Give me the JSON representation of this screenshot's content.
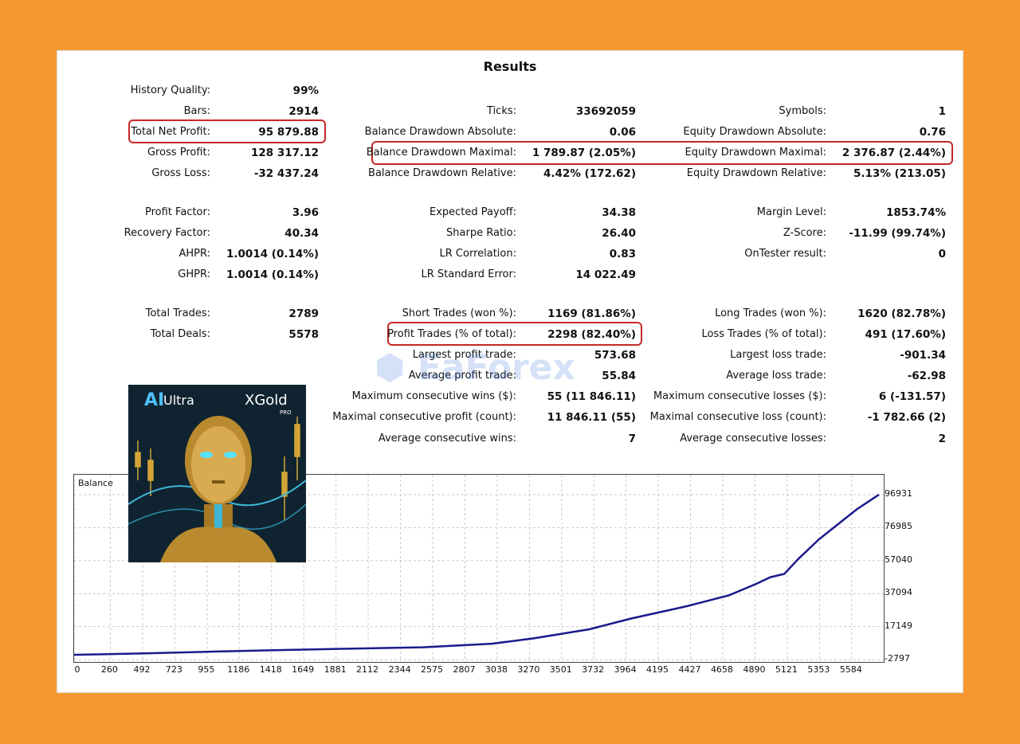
{
  "title": "Results",
  "col1": [
    {
      "label": "History Quality:",
      "value": "99%"
    },
    {
      "label": "Bars:",
      "value": "2914"
    },
    {
      "label": "Total Net Profit:",
      "value": "95 879.88"
    },
    {
      "label": "Gross Profit:",
      "value": "128 317.12"
    },
    {
      "label": "Gross Loss:",
      "value": "-32 437.24"
    },
    {
      "label": "Profit Factor:",
      "value": "3.96"
    },
    {
      "label": "Recovery Factor:",
      "value": "40.34"
    },
    {
      "label": "AHPR:",
      "value": "1.0014 (0.14%)"
    },
    {
      "label": "GHPR:",
      "value": "1.0014 (0.14%)"
    },
    {
      "label": "Total Trades:",
      "value": "2789"
    },
    {
      "label": "Total Deals:",
      "value": "5578"
    }
  ],
  "col2": [
    {
      "label": "Ticks:",
      "value": "33692059"
    },
    {
      "label": "Balance Drawdown Absolute:",
      "value": "0.06"
    },
    {
      "label": "Balance Drawdown Maximal:",
      "value": "1 789.87 (2.05%)"
    },
    {
      "label": "Balance Drawdown Relative:",
      "value": "4.42% (172.62)"
    },
    {
      "label": "Expected Payoff:",
      "value": "34.38"
    },
    {
      "label": "Sharpe Ratio:",
      "value": "26.40"
    },
    {
      "label": "LR Correlation:",
      "value": "0.83"
    },
    {
      "label": "LR Standard Error:",
      "value": "14 022.49"
    },
    {
      "label": "Short Trades (won %):",
      "value": "1169 (81.86%)"
    },
    {
      "label": "Profit Trades (% of total):",
      "value": "2298 (82.40%)"
    },
    {
      "label": "Largest profit trade:",
      "value": "573.68"
    },
    {
      "label": "Average profit trade:",
      "value": "55.84"
    },
    {
      "label": "Maximum consecutive wins ($):",
      "value": "55 (11 846.11)"
    },
    {
      "label": "Maximal consecutive profit (count):",
      "value": "11 846.11 (55)"
    },
    {
      "label": "Average consecutive wins:",
      "value": "7"
    }
  ],
  "col3": [
    {
      "label": "Symbols:",
      "value": "1"
    },
    {
      "label": "Equity Drawdown Absolute:",
      "value": "0.76"
    },
    {
      "label": "Equity Drawdown Maximal:",
      "value": "2 376.87 (2.44%)"
    },
    {
      "label": "Equity Drawdown Relative:",
      "value": "5.13% (213.05)"
    },
    {
      "label": "Margin Level:",
      "value": "1853.74%"
    },
    {
      "label": "Z-Score:",
      "value": "-11.99 (99.74%)"
    },
    {
      "label": "OnTester result:",
      "value": "0"
    },
    {
      "label": "Long Trades (won %):",
      "value": "1620 (82.78%)"
    },
    {
      "label": "Loss Trades (% of total):",
      "value": "491 (17.60%)"
    },
    {
      "label": "Largest loss trade:",
      "value": "-901.34"
    },
    {
      "label": "Average loss trade:",
      "value": "-62.98"
    },
    {
      "label": "Maximum consecutive losses ($):",
      "value": "6 (-131.57)"
    },
    {
      "label": "Maximal consecutive loss (count):",
      "value": "-1 782.66 (2)"
    },
    {
      "label": "Average consecutive losses:",
      "value": "2"
    }
  ],
  "watermark": "EaForex",
  "product": {
    "ai": "AI",
    "ultra": "Ultra",
    "xgold": "XGold",
    "pro": "PRO"
  },
  "colors": {
    "background": "#f7982f",
    "highlight": "#c62828",
    "line": "#1a1a8c"
  },
  "chart_data": {
    "type": "line",
    "label": "Balance",
    "x_ticks": [
      "0",
      "260",
      "492",
      "723",
      "955",
      "1186",
      "1418",
      "1649",
      "1881",
      "2112",
      "2344",
      "2575",
      "2807",
      "3038",
      "3270",
      "3501",
      "3732",
      "3964",
      "4195",
      "4427",
      "4658",
      "4890",
      "5121",
      "5353",
      "5584"
    ],
    "y_ticks": [
      "96931",
      "76985",
      "57040",
      "37094",
      "17149",
      "-2797"
    ],
    "ylim": [
      -2797,
      96931
    ],
    "xlim": [
      0,
      5780
    ],
    "x": [
      0,
      500,
      1000,
      1500,
      2000,
      2500,
      3000,
      3300,
      3700,
      4000,
      4400,
      4700,
      4900,
      5000,
      5100,
      5200,
      5350,
      5500,
      5620,
      5780
    ],
    "y": [
      100,
      900,
      2000,
      3000,
      3800,
      4600,
      6800,
      10000,
      15500,
      22000,
      29500,
      36000,
      43000,
      47000,
      49000,
      58000,
      70000,
      80000,
      88000,
      97000
    ]
  }
}
